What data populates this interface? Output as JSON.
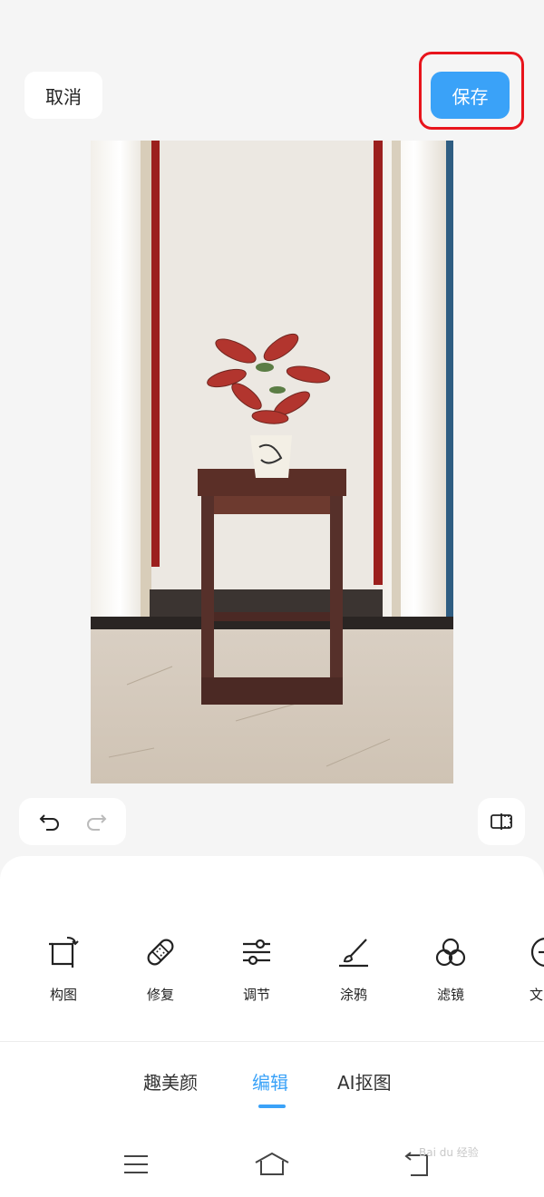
{
  "header": {
    "cancel_label": "取消",
    "save_label": "保存",
    "accent_color": "#3aa2f8",
    "highlight_color": "#e8141c"
  },
  "photo": {
    "subject": "plant-on-wooden-stand"
  },
  "history": {
    "undo_icon": "undo-icon",
    "redo_icon": "redo-icon",
    "compare_icon": "compare-icon"
  },
  "tools": [
    {
      "label": "构图",
      "icon": "crop-rotate-icon"
    },
    {
      "label": "修复",
      "icon": "bandage-icon"
    },
    {
      "label": "调节",
      "icon": "sliders-icon"
    },
    {
      "label": "涂鸦",
      "icon": "brush-icon"
    },
    {
      "label": "滤镜",
      "icon": "filter-circles-icon"
    },
    {
      "label": "文",
      "icon": "text-icon"
    }
  ],
  "tabs": [
    {
      "label": "趣美颜",
      "active": false
    },
    {
      "label": "编辑",
      "active": true
    },
    {
      "label": "AI抠图",
      "active": false
    }
  ],
  "navbar": {
    "menu_icon": "menu-icon",
    "home_icon": "home-icon",
    "back_icon": "back-icon"
  },
  "watermark": "Bai du 经验"
}
